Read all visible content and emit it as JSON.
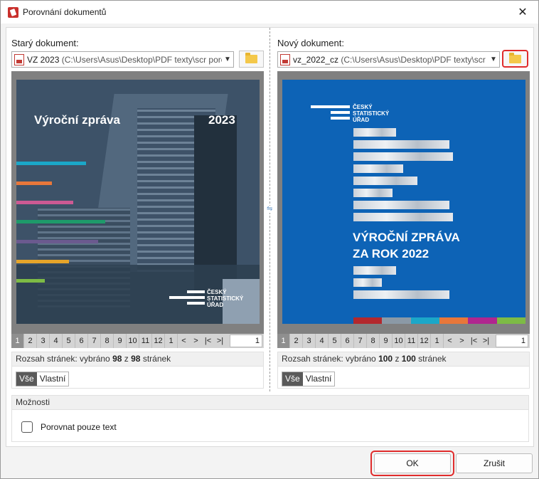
{
  "window": {
    "title": "Porovnání dokumentů"
  },
  "old_doc": {
    "label": "Starý dokument:",
    "file_name": "VZ 2023",
    "file_path": " (C:\\Users\\Asus\\Desktop\\PDF texty\\scr porov",
    "cover_title": "Výroční zpráva",
    "cover_year": "2023",
    "logo_line1": "ČESKÝ",
    "logo_line2": "STATISTICKÝ",
    "logo_line3": "ÚŘAD",
    "pages": [
      "1",
      "2",
      "3",
      "4",
      "5",
      "6",
      "7",
      "8",
      "9",
      "10",
      "11",
      "12",
      "1"
    ],
    "page_input": "1",
    "range_prefix": "Rozsah stránek: vybráno",
    "range_selected": "98",
    "range_of": "z",
    "range_total": "98",
    "range_suffix": "stránek",
    "seg_all": "Vše",
    "seg_custom": "Vlastní",
    "bar_colors": [
      "#1ba7c8",
      "#e8773a",
      "#cc5a93",
      "#1e9a6a",
      "#6b5a8f",
      "#e6a52a",
      "#7dbb45"
    ]
  },
  "new_doc": {
    "label": "Nový dokument:",
    "file_name": "vz_2022_cz",
    "file_path": " (C:\\Users\\Asus\\Desktop\\PDF texty\\scr po",
    "cover_title_line1": "VÝROČNÍ ZPRÁVA",
    "cover_title_line2": "ZA ROK 2022",
    "logo_line1": "ČESKÝ",
    "logo_line2": "STATISTICKÝ",
    "logo_line3": "ÚŘAD",
    "pages": [
      "1",
      "2",
      "3",
      "4",
      "5",
      "6",
      "7",
      "8",
      "9",
      "10",
      "11",
      "12",
      "1"
    ],
    "page_input": "1",
    "range_prefix": "Rozsah stránek: vybráno",
    "range_selected": "100",
    "range_of": "z",
    "range_total": "100",
    "range_suffix": "stránek",
    "seg_all": "Vše",
    "seg_custom": "Vlastní",
    "footer_colors": [
      "#b3282d",
      "#8b99a6",
      "#1ba7c8",
      "#e8773a",
      "#b0268f",
      "#7dbb45"
    ]
  },
  "nav": {
    "prev": "<",
    "next": ">",
    "first": "|<",
    "last": ">|"
  },
  "options": {
    "heading": "Možnosti",
    "text_only_label": "Porovnat pouze text"
  },
  "buttons": {
    "ok": "OK",
    "cancel": "Zrušit"
  }
}
